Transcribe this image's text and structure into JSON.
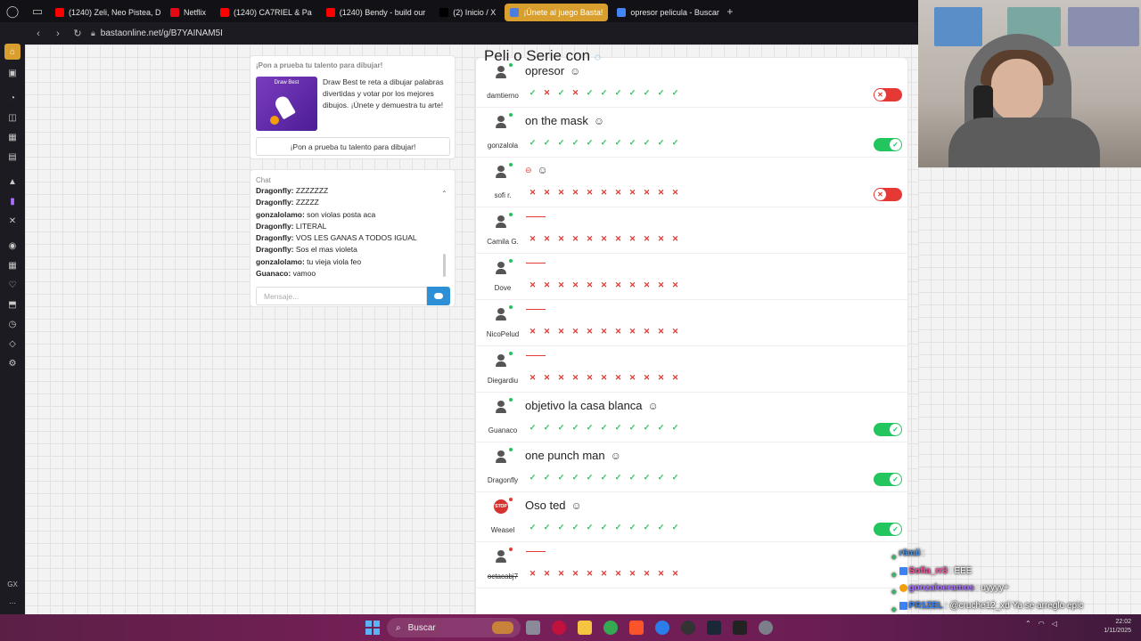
{
  "tabs": [
    {
      "label": "(1240) Zeli, Neo Pistea, D",
      "color": "#ff0000",
      "active": false
    },
    {
      "label": "Netflix",
      "color": "#e50914",
      "active": false
    },
    {
      "label": "(1240) CA7RIEL & Pa",
      "color": "#ff0000",
      "active": false
    },
    {
      "label": "(1240) Bendy - build our",
      "color": "#ff0000",
      "active": false
    },
    {
      "label": "(2) Inicio / X",
      "color": "#000000",
      "active": false
    },
    {
      "label": "¡Únete al juego Basta!",
      "color": "#4a7de0",
      "active": true
    },
    {
      "label": "opresor pelicula - Buscar",
      "color": "#4285f4",
      "active": false
    }
  ],
  "address": {
    "url": "bastaonline.net/g/B7YAINAM5I"
  },
  "promo": {
    "title": "¡Pon a prueba tu talento para dibujar!",
    "image_title": "Draw Best",
    "text": "Draw Best te reta a dibujar palabras divertidas y votar por los mejores dibujos. ¡Únete y demuestra tu arte!",
    "button": "¡Pon a prueba tu talento para dibujar!"
  },
  "chat": {
    "title": "Chat",
    "messages": [
      {
        "user": "Dragonfly:",
        "text": "ZZZZZZZ"
      },
      {
        "user": "Dragonfly:",
        "text": "ZZZZZ"
      },
      {
        "user": "gonzalolamo:",
        "text": "son violas posta aca"
      },
      {
        "user": "Dragonfly:",
        "text": "LITERAL"
      },
      {
        "user": "Dragonfly:",
        "text": "VOS LES GANAS A TODOS IGUAL"
      },
      {
        "user": "Dragonfly:",
        "text": "Sos el mas violeta"
      },
      {
        "user": "gonzalolamo:",
        "text": "tu vieja viola feo"
      },
      {
        "user": "Guanaco:",
        "text": "vamoo"
      }
    ],
    "input_placeholder": "Mensaje..."
  },
  "results": {
    "heading": "Peli o Serie con",
    "rows": [
      {
        "user": "damtierno",
        "answer": "opresor",
        "has_answer": true,
        "votes": [
          "y",
          "n",
          "y",
          "n",
          "y",
          "y",
          "y",
          "y",
          "y",
          "y",
          "y"
        ],
        "toggle": "off",
        "online": true
      },
      {
        "user": "gonzalola",
        "answer": "on the mask",
        "has_answer": true,
        "votes": [
          "y",
          "y",
          "y",
          "y",
          "y",
          "y",
          "y",
          "y",
          "y",
          "y",
          "y"
        ],
        "toggle": "on",
        "online": true
      },
      {
        "user": "sofi r.",
        "answer": "",
        "has_answer": true,
        "blocked": true,
        "votes": [
          "n",
          "n",
          "n",
          "n",
          "n",
          "n",
          "n",
          "n",
          "n",
          "n",
          "n"
        ],
        "toggle": "off",
        "online": true
      },
      {
        "user": "Camila G.",
        "answer": "",
        "has_answer": false,
        "votes": [
          "n",
          "n",
          "n",
          "n",
          "n",
          "n",
          "n",
          "n",
          "n",
          "n",
          "n"
        ],
        "toggle": "",
        "online": true
      },
      {
        "user": "Dove",
        "answer": "",
        "has_answer": false,
        "votes": [
          "n",
          "n",
          "n",
          "n",
          "n",
          "n",
          "n",
          "n",
          "n",
          "n",
          "n"
        ],
        "toggle": "",
        "online": true
      },
      {
        "user": "NicoPelud",
        "answer": "",
        "has_answer": false,
        "votes": [
          "n",
          "n",
          "n",
          "n",
          "n",
          "n",
          "n",
          "n",
          "n",
          "n",
          "n"
        ],
        "toggle": "",
        "online": true
      },
      {
        "user": "Diegardiu",
        "answer": "",
        "has_answer": false,
        "votes": [
          "n",
          "n",
          "n",
          "n",
          "n",
          "n",
          "n",
          "n",
          "n",
          "n",
          "n"
        ],
        "toggle": "",
        "online": true
      },
      {
        "user": "Guanaco",
        "answer": "objetivo la casa blanca",
        "has_answer": true,
        "votes": [
          "y",
          "y",
          "y",
          "y",
          "y",
          "y",
          "y",
          "y",
          "y",
          "y",
          "y"
        ],
        "toggle": "on",
        "online": true
      },
      {
        "user": "Dragonfly",
        "answer": "one punch man",
        "has_answer": true,
        "votes": [
          "y",
          "y",
          "y",
          "y",
          "y",
          "y",
          "y",
          "y",
          "y",
          "y",
          "y"
        ],
        "toggle": "on",
        "online": true
      },
      {
        "user": "Weasel",
        "answer": "Oso ted",
        "has_answer": true,
        "votes": [
          "y",
          "y",
          "y",
          "y",
          "y",
          "y",
          "y",
          "y",
          "y",
          "y",
          "y"
        ],
        "toggle": "on",
        "online": false,
        "stop_avatar": true
      },
      {
        "user": "octacabj7",
        "answer": "",
        "has_answer": false,
        "votes": [
          "n",
          "n",
          "n",
          "n",
          "n",
          "n",
          "n",
          "n",
          "n",
          "n",
          "n"
        ],
        "toggle": "",
        "online": false,
        "strike": true
      }
    ]
  },
  "twitch_chat": [
    {
      "user": "r6mii",
      "text": ":",
      "color": "#4a90e2"
    },
    {
      "user": "Sofia_rr3",
      "text": ": EEE",
      "color": "#ff4fa3"
    },
    {
      "user": "gonzaloeramos",
      "text": ": uyyyy+",
      "color": "#a970ff"
    },
    {
      "user": "PR1ZEL",
      "text": ": @cruche12_xd Ya se arreglo epic",
      "color": "#3b82f6"
    },
    {
      "user": "r6mii",
      "text": ":",
      "color": "#4a90e2"
    }
  ],
  "taskbar": {
    "search": "Buscar",
    "time": "22:02",
    "date": "1/11/2025"
  },
  "sidebar": {
    "gx_label": "GX"
  },
  "icons": {
    "search": "search-icon",
    "smile": "smile-icon",
    "check": "check-icon",
    "cross": "cross-icon"
  }
}
